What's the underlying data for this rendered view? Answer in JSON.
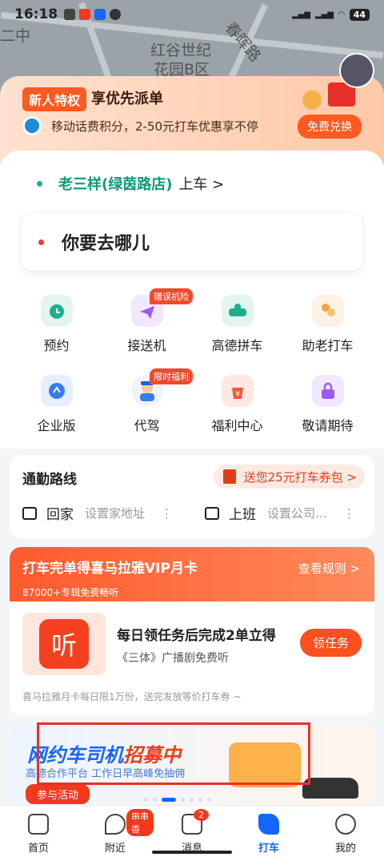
{
  "status_bar": {
    "time": "16:18",
    "battery": "44"
  },
  "map": {
    "label_1": "红谷世纪",
    "label_2": "花园B区",
    "label_3": "二中",
    "label_4": "春晖路"
  },
  "promo": {
    "badge": "新人特权",
    "title": "享优先派单",
    "subtitle": "移动话费积分，2-50元打车优惠享不停",
    "exchange_button": "免费兑换"
  },
  "pickup": {
    "place": "老三样(绿茵路店)",
    "suffix": "上车 >"
  },
  "destination": {
    "placeholder": "你要去哪儿"
  },
  "services": [
    {
      "label": "预约",
      "icon": "clock-icon",
      "tag": ""
    },
    {
      "label": "接送机",
      "icon": "plane-icon",
      "tag": "赠误机险"
    },
    {
      "label": "高德拼车",
      "icon": "carpool-icon",
      "tag": ""
    },
    {
      "label": "助老打车",
      "icon": "elderly-icon",
      "tag": ""
    },
    {
      "label": "企业版",
      "icon": "enterprise-icon",
      "tag": ""
    },
    {
      "label": "代驾",
      "icon": "driver-icon",
      "tag": "限时福利"
    },
    {
      "label": "福利中心",
      "icon": "welfare-icon",
      "tag": ""
    },
    {
      "label": "敬请期待",
      "icon": "lock-icon",
      "tag": ""
    }
  ],
  "commute": {
    "title": "通勤路线",
    "coupon": "送您25元打车券包 >",
    "home_label": "回家",
    "home_hint": "设置家地址",
    "work_label": "上班",
    "work_hint": "设置公司…",
    "more": "⋮"
  },
  "vip": {
    "title": "打车完单得喜马拉雅VIP月卡",
    "subtitle": "87000+专辑免费畅听",
    "rules": "查看规则 >",
    "logo_char": "听",
    "headline": "每日领任务后完成2单立得",
    "desc": "《三体》广播剧免费听",
    "button": "领任务",
    "note": "喜马拉雅月卡每日限1万份，送完发放等价打车券 ~"
  },
  "banner": {
    "title_blue": "网约车司机",
    "title_red": "招募中",
    "subtitle": "高德合作平台 工作日早高峰免抽佣",
    "join": "参与活动"
  },
  "nav": [
    {
      "label": "首页",
      "icon": "bus-icon",
      "badge": ""
    },
    {
      "label": "附近",
      "icon": "heart-icon",
      "badge": "串串香"
    },
    {
      "label": "消息",
      "icon": "message-icon",
      "badge": "2"
    },
    {
      "label": "打车",
      "icon": "taxi-icon",
      "badge": ""
    },
    {
      "label": "我的",
      "icon": "person-icon",
      "badge": ""
    }
  ],
  "colors": {
    "accent": "#1466ff",
    "orange": "#ff5a1f",
    "green": "#0e9a76",
    "red_dot": "#f03a3a"
  }
}
